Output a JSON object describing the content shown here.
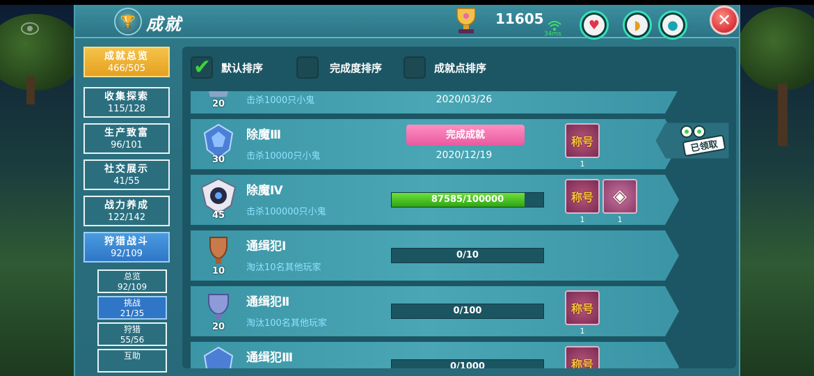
{
  "header": {
    "title": "成就",
    "points": "11605",
    "ping": "34ms",
    "close_label": "✕"
  },
  "sidebar": {
    "categories": [
      {
        "label": "成就总览",
        "count": "466/505"
      },
      {
        "label": "收集探索",
        "count": "115/128"
      },
      {
        "label": "生产致富",
        "count": "96/101"
      },
      {
        "label": "社交展示",
        "count": "41/55"
      },
      {
        "label": "战力养成",
        "count": "122/142"
      },
      {
        "label": "狩猎战斗",
        "count": "92/109"
      }
    ],
    "subcategories": [
      {
        "label": "总览",
        "count": "92/109"
      },
      {
        "label": "挑战",
        "count": "21/35"
      },
      {
        "label": "狩猎",
        "count": "55/56"
      },
      {
        "label": "互助",
        "count": ""
      }
    ]
  },
  "sort": {
    "default": "默认排序",
    "completion": "完成度排序",
    "points": "成就点排序"
  },
  "achievements": [
    {
      "name": "",
      "desc": "击杀1000只小鬼",
      "badge": "20",
      "date": "2020/03/26"
    },
    {
      "name": "除魔Ⅲ",
      "desc": "击杀10000只小鬼",
      "badge": "30",
      "status": "完成成就",
      "date": "2020/12/19",
      "reward_label": "称号",
      "reward_count": "1"
    },
    {
      "name": "除魔Ⅳ",
      "desc": "击杀100000只小鬼",
      "badge": "45",
      "progress_text": "87585/100000",
      "progress": 0.87585,
      "reward_label": "称号",
      "reward_count": "1",
      "reward2_count": "1"
    },
    {
      "name": "通缉犯Ⅰ",
      "desc": "淘汰10名其他玩家",
      "badge": "10",
      "progress_text": "0/10",
      "progress": 0
    },
    {
      "name": "通缉犯Ⅱ",
      "desc": "淘汰100名其他玩家",
      "badge": "20",
      "progress_text": "0/100",
      "progress": 0,
      "reward_label": "称号",
      "reward_count": "1"
    },
    {
      "name": "通缉犯Ⅲ",
      "desc": "",
      "badge": "",
      "progress_text": "0/1000",
      "progress": 0,
      "reward_label": "称号"
    }
  ],
  "claim_label": "已领取",
  "colors": {
    "panel": "#2f7a8a",
    "progress_fill": "#2ea514",
    "ribbon": "#e85a9f",
    "active_tab": "#e5a120"
  }
}
